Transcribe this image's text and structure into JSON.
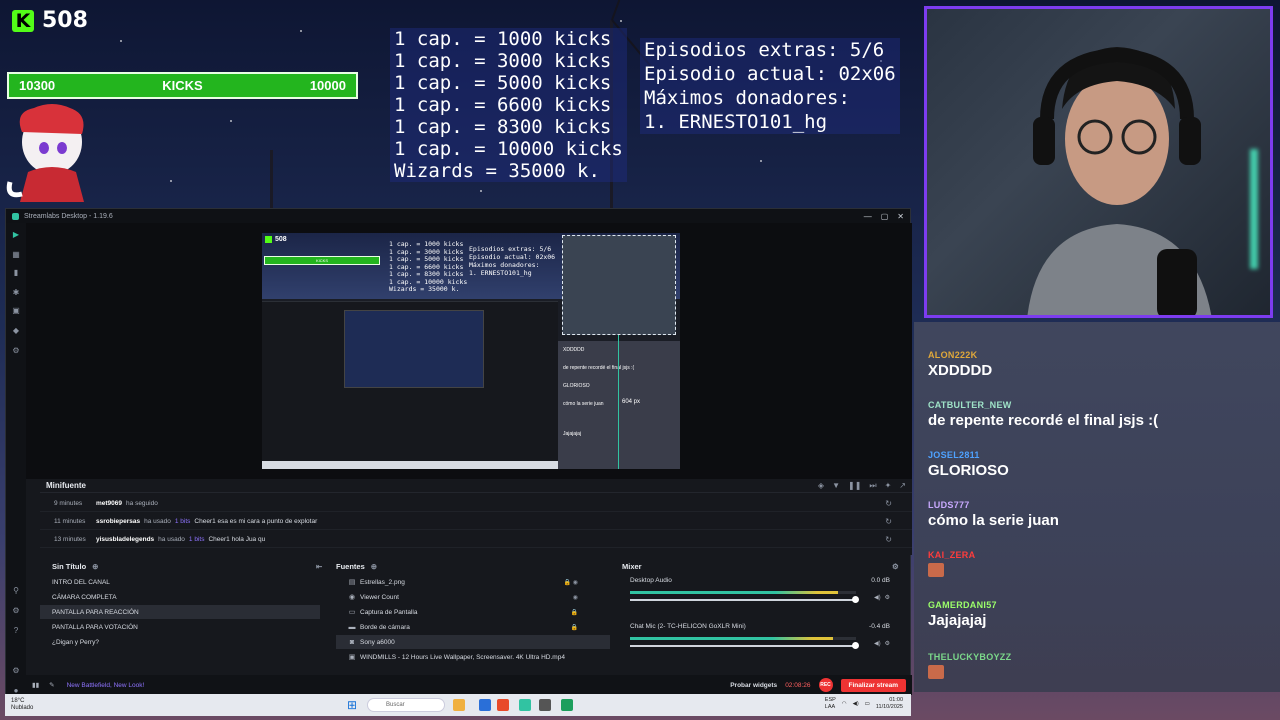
{
  "overlay": {
    "kick_count": "508",
    "kick_logo": "K",
    "kick_bar": {
      "left": "10300",
      "label": "KICKS",
      "right": "10000"
    },
    "goals": [
      "1 cap. = 1000 kicks",
      "1 cap. = 3000 kicks",
      "1 cap. = 5000 kicks",
      "1 cap. = 6600 kicks",
      "1 cap. = 8300 kicks",
      "1 cap. = 10000 kicks",
      "Wizards = 35000 k."
    ],
    "episodes": [
      "Episodios extras: 5/6",
      "Episodio actual: 02x06",
      "Máximos donadores:",
      "1. ERNESTO101_hg"
    ]
  },
  "chat": {
    "messages": [
      {
        "user": "ALON222K",
        "text": "XDDDDD",
        "color": "#e0a83a"
      },
      {
        "user": "CATBULTER_NEW",
        "text": "de repente recordé el final jsjs :(",
        "color": "#9fe3c8"
      },
      {
        "user": "JOSEL2811",
        "text": "GLORIOSO",
        "color": "#4ea2ff"
      },
      {
        "user": "LUDS777",
        "text": "cómo la serie juan",
        "color": "#c9a9ff"
      },
      {
        "user": "KAI_ZERA",
        "text": "",
        "color": "#ff3c3c"
      },
      {
        "user": "GAMERDANI57",
        "text": "Jajajajaj",
        "color": "#9cff6a"
      },
      {
        "user": "THELUCKYBOYZZ",
        "text": "",
        "color": "#7bd88a"
      }
    ]
  },
  "streamlabs": {
    "title": "Streamlabs Desktop - 1.19.6",
    "window_buttons": [
      "—",
      "▢",
      "✕"
    ],
    "preview": {
      "size_readout": "604 px",
      "chat_lines": [
        "XDDDDD",
        "de repente recordé el final jsjs :(",
        "GLORIOSO",
        "cómo la serie juan",
        "Jajajajaj"
      ]
    },
    "minifuente": {
      "title": "Minifuente",
      "events": [
        {
          "time": "9 minutes",
          "user": "met9069",
          "action": "ha seguido",
          "bits": "",
          "msg": ""
        },
        {
          "time": "11 minutes",
          "user": "ssrobiepersas",
          "action": "ha usado",
          "bits": "1 bits",
          "msg": "Cheer1 esa es mi cara a punto de explotar"
        },
        {
          "time": "13 minutes",
          "user": "yisusbladelegends",
          "action": "ha usado",
          "bits": "1 bits",
          "msg": "Cheer1 hola Jua qu"
        }
      ]
    },
    "scenes": {
      "title": "Sin Título",
      "items": [
        "INTRO DEL CANAL",
        "CÁMARA COMPLETA",
        "PANTALLA PARA REACCIÓN",
        "PANTALLA PARA VOTACIÓN",
        "¿Digan y Perry?"
      ]
    },
    "sources": {
      "title": "Fuentes",
      "items": [
        "Estrellas_2.png",
        "Viewer Count",
        "Captura de Pantalla",
        "Borde de cámara",
        "Sony a6000",
        "WINDMILLS - 12 Hours Live Wallpaper, Screensaver. 4K Ultra HD.mp4"
      ]
    },
    "mixer": {
      "title": "Mixer",
      "channels": [
        {
          "name": "Desktop Audio",
          "db": "0.0 dB",
          "level": 0.92
        },
        {
          "name": "Chat Mic (2- TC-HELICON GoXLR Mini)",
          "db": "-0.4 dB",
          "level": 0.9
        }
      ]
    },
    "footer": {
      "news": "New Battlefield, New Look!",
      "probar": "Probar widgets",
      "rec_time": "02:08:26",
      "rec_label": "REC",
      "end_stream": "Finalizar stream"
    }
  },
  "taskbar": {
    "weather_temp": "18°C",
    "weather_desc": "Nublado",
    "search_placeholder": "Buscar",
    "lang": "ESP",
    "lang2": "LAA",
    "time": "01:00",
    "date": "11/10/2025"
  }
}
